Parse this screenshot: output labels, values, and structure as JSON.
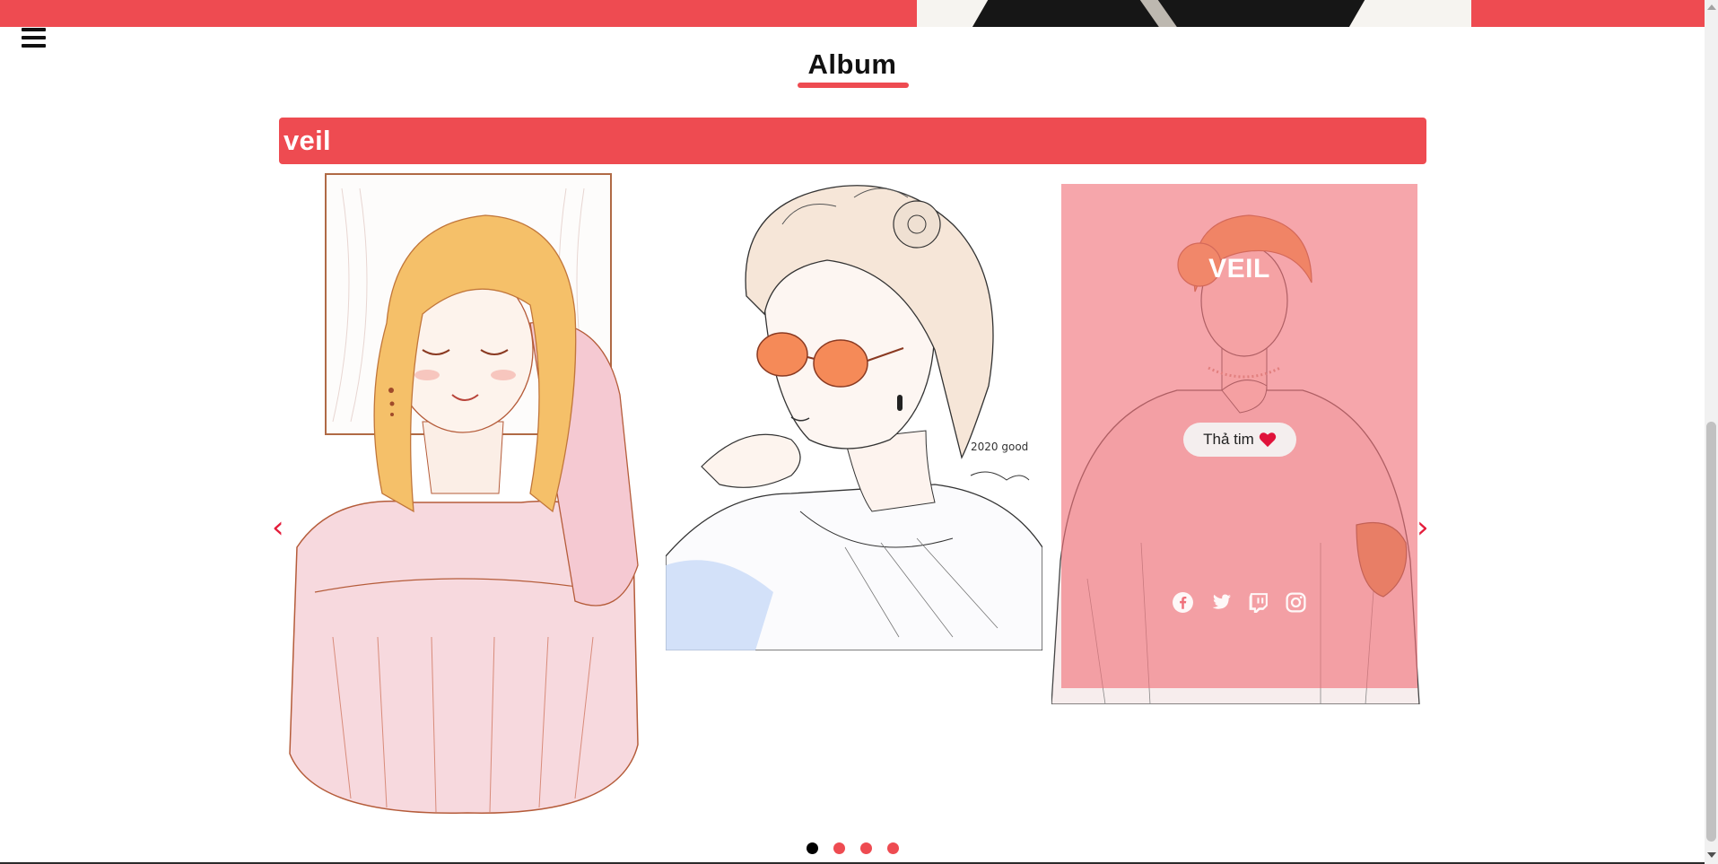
{
  "header": {
    "menu_icon": "hamburger-menu-icon",
    "section_title": "Album"
  },
  "album": {
    "name": "veil",
    "card": {
      "title": "VEIL",
      "like_label": "Thả tim",
      "like_icon": "heart-icon",
      "social_icons": [
        "facebook-icon",
        "twitter-icon",
        "twitch-icon",
        "instagram-icon"
      ]
    },
    "slides": [
      {
        "description": "illustration-girl-pink-top"
      },
      {
        "description": "illustration-girl-sunglasses"
      },
      {
        "description": "illustration-girl-fur-coat"
      }
    ],
    "artwork_signature": "2020 good"
  },
  "carousel": {
    "prev_glyph": "‹",
    "next_glyph": "›",
    "dot_count": 4,
    "active_dot": 1
  },
  "colors": {
    "accent": "#ee4b51",
    "arrow": "#e41d3b",
    "heart": "#e0123a",
    "overlay": "rgba(240, 112, 120, 0.62)"
  }
}
